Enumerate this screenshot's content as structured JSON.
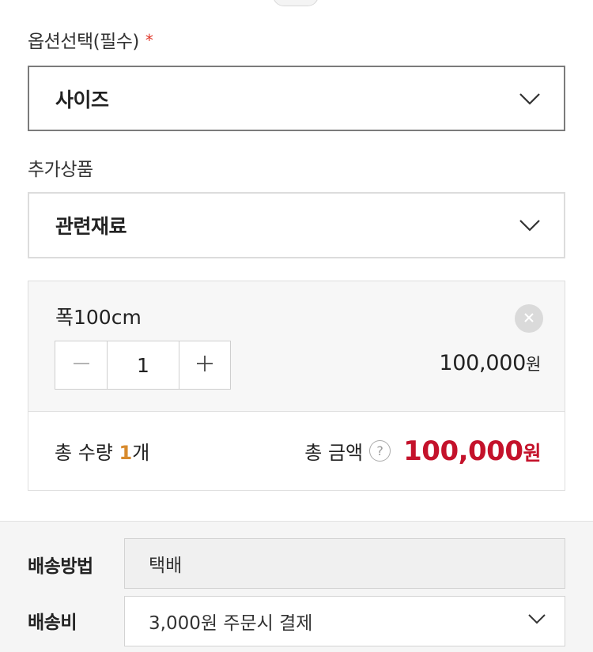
{
  "option_section": {
    "label": "옵션선택(필수)",
    "required_mark": "*",
    "select_value": "사이즈"
  },
  "addon_section": {
    "label": "추가상품",
    "select_value": "관련재료"
  },
  "selected_option": {
    "name": "폭100cm",
    "quantity": "1",
    "price": "100,000",
    "price_unit": "원"
  },
  "totals": {
    "qty_prefix": "총 수량 ",
    "qty_value": "1",
    "qty_suffix": "개",
    "amount_label": "총 금액",
    "help_symbol": "?",
    "amount_value": "100,000",
    "amount_unit": "원"
  },
  "shipping": {
    "method_label": "배송방법",
    "method_value": "택배",
    "fee_label": "배송비",
    "fee_value": "3,000원 주문시 결제"
  },
  "colors": {
    "accent_red": "#c4122b",
    "qty_orange": "#d88b2e",
    "required_red": "#e0392b"
  },
  "icons": [
    "chevron-down-icon",
    "close-icon",
    "minus-icon",
    "plus-icon",
    "help-icon"
  ]
}
